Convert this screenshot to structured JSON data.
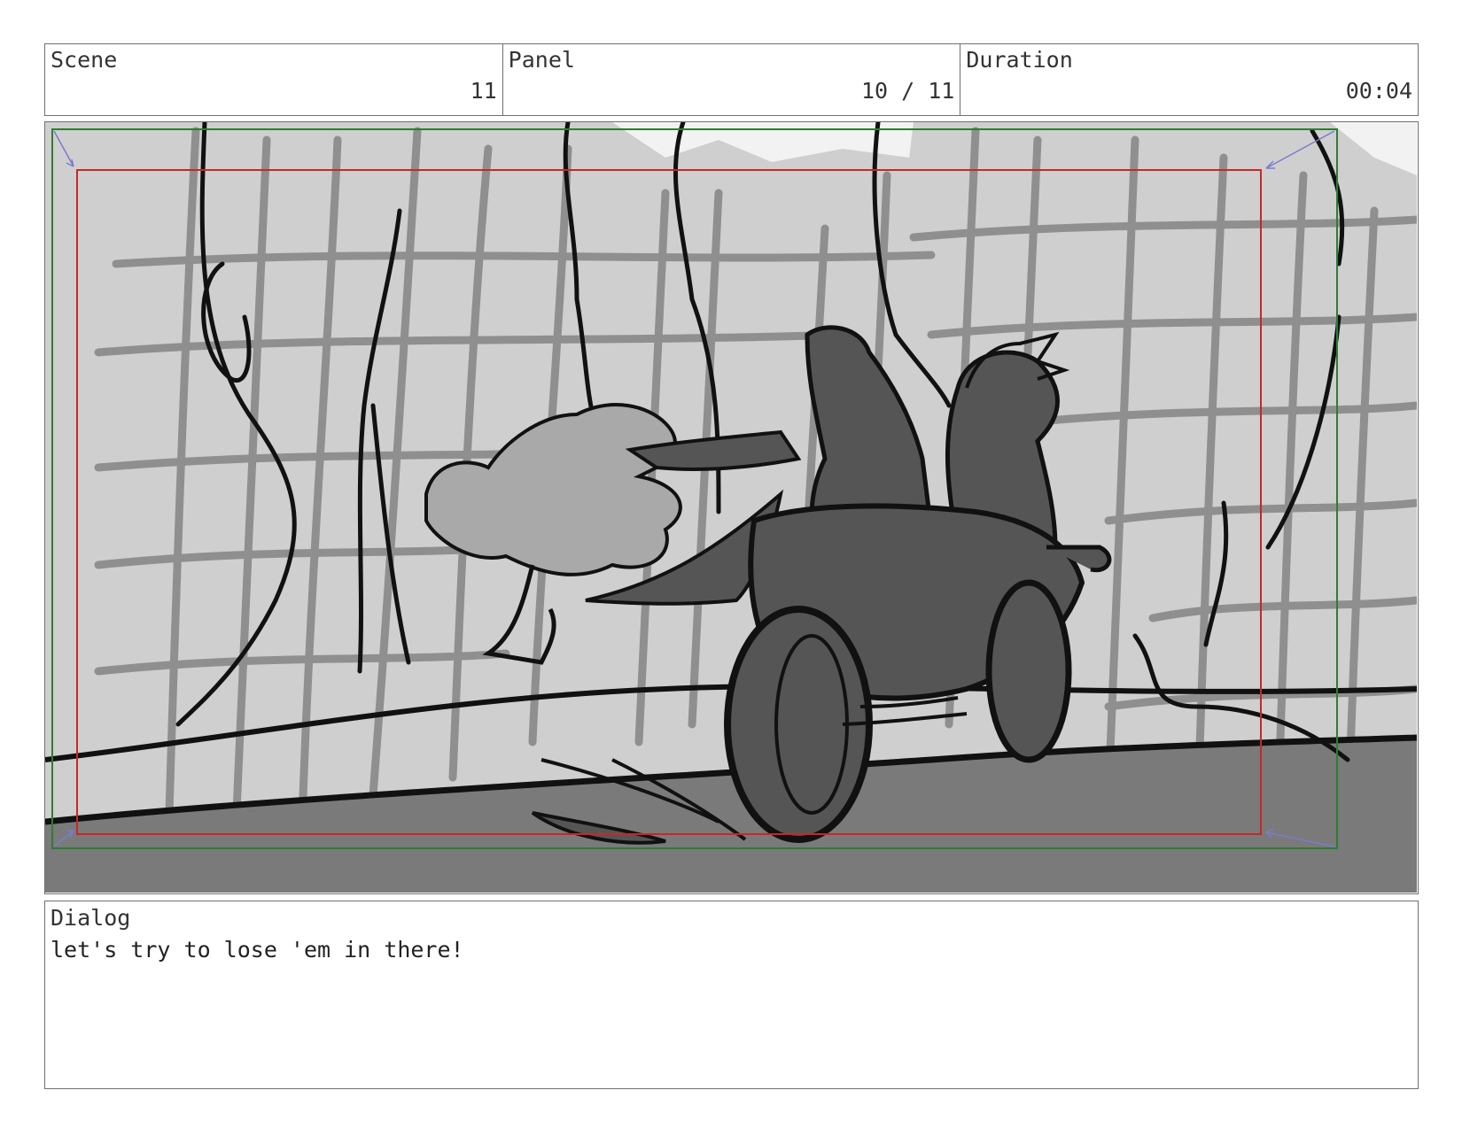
{
  "header": {
    "scene": {
      "label": "Scene",
      "value": "11"
    },
    "panel": {
      "label": "Panel",
      "value": "10 / 11"
    },
    "duration": {
      "label": "Duration",
      "value": "00:04"
    }
  },
  "frame": {
    "safe_area_color": "#2e7d32",
    "action_area_color": "#c62828",
    "corner_arrow_color": "#7b7bd0",
    "sketch_palette": {
      "background": "#cfcfcf",
      "grid_lines": "#8f8f8f",
      "ink": "#111111",
      "rider_fill": "#555555",
      "ground_fill": "#7a7a7a",
      "cloud_fill": "#a9a9a9"
    }
  },
  "dialog": {
    "label": "Dialog",
    "text": "let's try to lose 'em in there!"
  }
}
